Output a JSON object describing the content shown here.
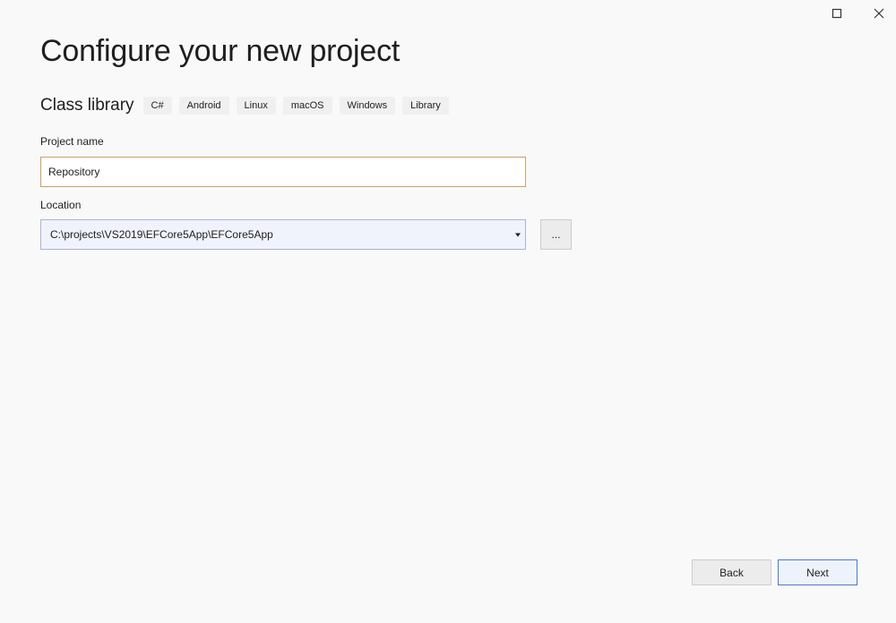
{
  "window": {
    "controls": {
      "maximize_icon": "maximize-icon",
      "close_icon": "close-icon"
    }
  },
  "page": {
    "title": "Configure your new project"
  },
  "template": {
    "name": "Class library",
    "tags": [
      "C#",
      "Android",
      "Linux",
      "macOS",
      "Windows",
      "Library"
    ]
  },
  "project_name": {
    "label": "Project name",
    "value": "Repository"
  },
  "location": {
    "label": "Location",
    "value": "C:\\projects\\VS2019\\EFCore5App\\EFCore5App",
    "browse_label": "..."
  },
  "footer": {
    "back_label": "Back",
    "next_label": "Next"
  },
  "colors": {
    "background": "#f9f9f9",
    "focus_border": "#c8a266",
    "combo_border": "#a9b3d6",
    "combo_background": "#f1f3fc",
    "primary_border": "#4a78d0",
    "tag_background": "#f0f0f0"
  }
}
